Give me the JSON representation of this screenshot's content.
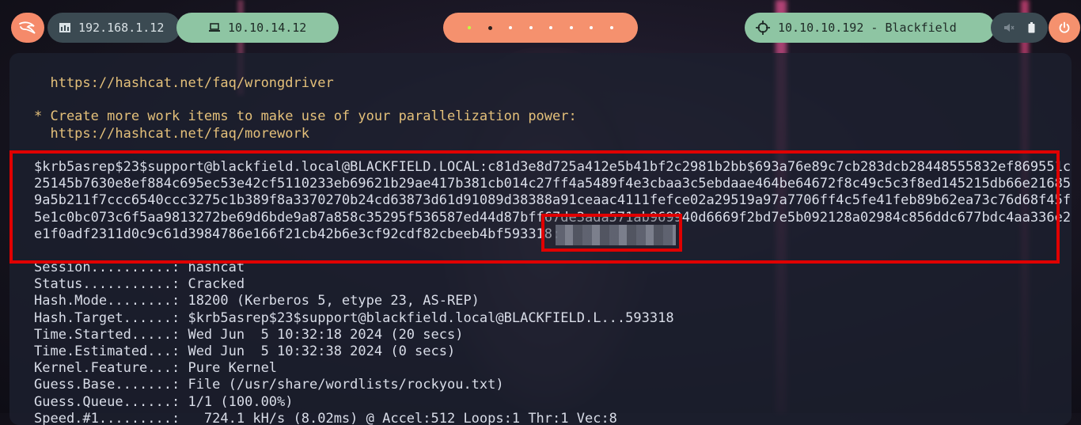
{
  "topbar": {
    "local_ip": "192.168.1.12",
    "vpn_ip": "10.10.14.12",
    "target": "10.10.10.192 - Blackfield",
    "workspaces_count": 8,
    "colors": {
      "accent_orange": "#f5916e",
      "accent_green": "#8ec5a3",
      "dark_pill": "#3b4a52"
    }
  },
  "terminal": {
    "pre_lines": [
      "  https://hashcat.net/faq/wrongdriver",
      "",
      "* Create more work items to make use of your parallelization power:",
      "  https://hashcat.net/faq/morework"
    ],
    "hash_lines": [
      "$krb5asrep$23$support@blackfield.local@BLACKFIELD.LOCAL:c81d3e8d725a412e5b41bf2c2981b2bb$693a76e89c7cb283dcb28448555832ef869551c",
      "25145b7630e8ef884c695ec53e42cf5110233eb69621b29ae417b381cb014c27ff4a5489f4e3cbaa3c5ebdaae464be64672f8c49c5c3f8ed145215db66e21685",
      "9a5b211f7ccc6540ccc3275c1b389f8a3370270b24cd63873d61d91089d38388a91ceaac4111fefce02a29519a97a7706ff4c5fe41feb89b62ea73c76d68f45f",
      "5e1c0bc073c6f5aa9813272be69d6bde9a87a858c35295f536587ed44d87bff67de3ada571ab969940d6669f2bd7e5b092128a02984c856ddc677bdc4aa336e2",
      "e1f0adf2311d0c9c61d3984786e166f21cb42b6e3cf92cdf82cbeeb4bf593318:"
    ],
    "status_lines": [
      "Session..........: hashcat",
      "Status...........: Cracked",
      "Hash.Mode........: 18200 (Kerberos 5, etype 23, AS-REP)",
      "Hash.Target......: $krb5asrep$23$support@blackfield.local@BLACKFIELD.L...593318",
      "Time.Started.....: Wed Jun  5 10:32:18 2024 (20 secs)",
      "Time.Estimated...: Wed Jun  5 10:32:38 2024 (0 secs)",
      "Kernel.Feature...: Pure Kernel",
      "Guess.Base.......: File (/usr/share/wordlists/rockyou.txt)",
      "Guess.Queue......: 1/1 (100.00%)",
      "Speed.#1.........:   724.1 kH/s (8.02ms) @ Accel:512 Loops:1 Thr:1 Vec:8"
    ]
  }
}
